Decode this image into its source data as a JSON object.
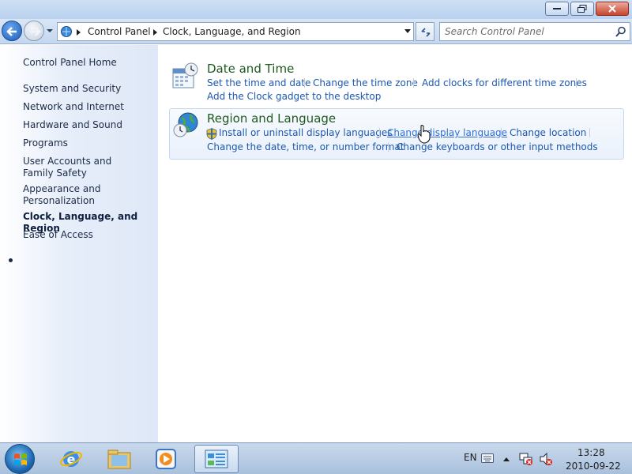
{
  "window": {
    "buttons": [
      "minimize",
      "maximize",
      "close"
    ]
  },
  "navigation": {
    "breadcrumbs": [
      "Control Panel",
      "Clock, Language, and Region"
    ],
    "search_placeholder": "Search Control Panel"
  },
  "sidebar": {
    "items": [
      {
        "label": "Control Panel Home"
      },
      {
        "label": "System and Security"
      },
      {
        "label": "Network and Internet"
      },
      {
        "label": "Hardware and Sound"
      },
      {
        "label": "Programs"
      },
      {
        "label": "User Accounts and Family Safety"
      },
      {
        "label": "Appearance and Personalization"
      },
      {
        "label": "Clock, Language, and Region",
        "active": true
      },
      {
        "label": "Ease of Access"
      }
    ]
  },
  "sections": [
    {
      "title": "Date and Time",
      "icon": "calendar-clock-icon",
      "links": [
        "Set the time and date",
        "Change the time zone",
        "Add clocks for different time zones",
        "Add the Clock gadget to the desktop"
      ]
    },
    {
      "title": "Region and Language",
      "icon": "globe-clock-icon",
      "links": [
        "Install or uninstall display languages",
        "Change display language",
        "Change location",
        "Change the date, time, or number format",
        "Change keyboards or other input methods"
      ]
    }
  ],
  "taskbar": {
    "apps": [
      "start-orb",
      "internet-explorer",
      "windows-explorer",
      "media-player",
      "control-panel"
    ],
    "language": "EN",
    "time": "13:28",
    "date": "2010-09-22"
  },
  "colors": {
    "link": "#1c57b0",
    "section_title": "#1e5a1e",
    "sidebar_bg": "#dfe8f7"
  }
}
